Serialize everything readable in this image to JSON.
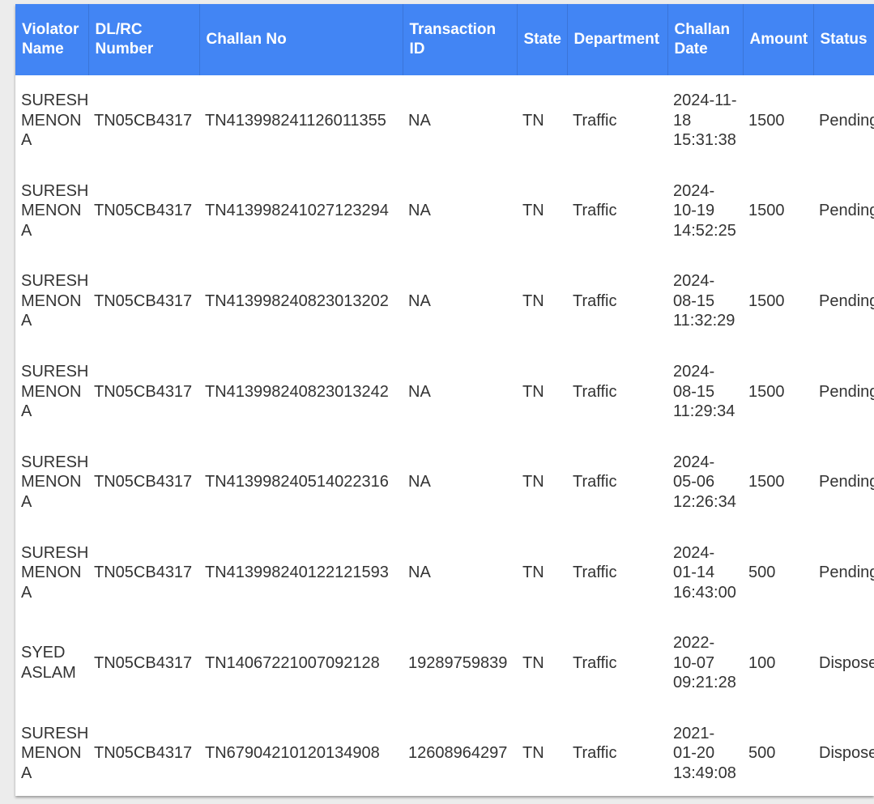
{
  "table": {
    "headers": [
      "Violator Name",
      "DL/RC Number",
      "Challan No",
      "Transaction ID",
      "State",
      "Department",
      "Challan Date",
      "Amount",
      "Status"
    ],
    "rows": [
      {
        "name": "SURESH MENON A",
        "dl": "TN05CB4317",
        "challan": "TN413998241126011355",
        "txn": "NA",
        "state": "TN",
        "dept": "Traffic",
        "date": "2024-11-18 15:31:38",
        "amount": "1500",
        "status": "Pending"
      },
      {
        "name": "SURESH MENON A",
        "dl": "TN05CB4317",
        "challan": "TN413998241027123294",
        "txn": "NA",
        "state": "TN",
        "dept": "Traffic",
        "date": "2024-10-19 14:52:25",
        "amount": "1500",
        "status": "Pending"
      },
      {
        "name": "SURESH MENON A",
        "dl": "TN05CB4317",
        "challan": "TN413998240823013202",
        "txn": "NA",
        "state": "TN",
        "dept": "Traffic",
        "date": "2024-08-15 11:32:29",
        "amount": "1500",
        "status": "Pending"
      },
      {
        "name": "SURESH MENON A",
        "dl": "TN05CB4317",
        "challan": "TN413998240823013242",
        "txn": "NA",
        "state": "TN",
        "dept": "Traffic",
        "date": "2024-08-15 11:29:34",
        "amount": "1500",
        "status": "Pending"
      },
      {
        "name": "SURESH MENON A",
        "dl": "TN05CB4317",
        "challan": "TN413998240514022316",
        "txn": "NA",
        "state": "TN",
        "dept": "Traffic",
        "date": "2024-05-06 12:26:34",
        "amount": "1500",
        "status": "Pending"
      },
      {
        "name": "SURESH MENON A",
        "dl": "TN05CB4317",
        "challan": "TN413998240122121593",
        "txn": "NA",
        "state": "TN",
        "dept": "Traffic",
        "date": "2024-01-14 16:43:00",
        "amount": "500",
        "status": "Pending"
      },
      {
        "name": "SYED ASLAM",
        "dl": "TN05CB4317",
        "challan": "TN14067221007092128",
        "txn": "19289759839",
        "state": "TN",
        "dept": "Traffic",
        "date": "2022-10-07 09:21:28",
        "amount": "100",
        "status": "Disposed"
      },
      {
        "name": "SURESH MENON A",
        "dl": "TN05CB4317",
        "challan": "TN67904210120134908",
        "txn": "12608964297",
        "state": "TN",
        "dept": "Traffic",
        "date": "2021-01-20 13:49:08",
        "amount": "500",
        "status": "Disposed"
      }
    ]
  },
  "colors": {
    "header_bg": "#4285f4",
    "header_text": "#ffffff",
    "body_text": "#333333",
    "page_bg": "#ececec"
  }
}
